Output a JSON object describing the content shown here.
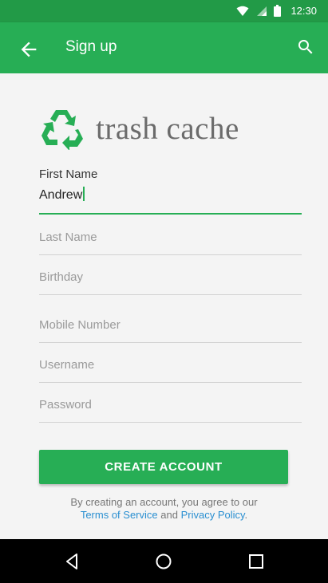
{
  "status_bar": {
    "time": "12:30",
    "icons": [
      "wifi-icon",
      "signal-icon",
      "battery-icon"
    ]
  },
  "app_bar": {
    "title": "Sign up",
    "back_icon": "arrow-back-icon",
    "search_icon": "search-icon"
  },
  "logo": {
    "icon": "recycle-icon",
    "text": "trash cache"
  },
  "form": {
    "first_name": {
      "label": "First Name",
      "value": "Andrew"
    },
    "last_name": {
      "placeholder": "Last Name"
    },
    "birthday": {
      "placeholder": "Birthday"
    },
    "mobile": {
      "placeholder": "Mobile Number"
    },
    "username": {
      "placeholder": "Username"
    },
    "password": {
      "placeholder": "Password"
    }
  },
  "create_button": {
    "label": "CREATE ACCOUNT"
  },
  "terms": {
    "line1": "By creating an account, you agree to our",
    "tos": "Terms of Service",
    "and": "and",
    "privacy": "Privacy Policy",
    "period": "."
  },
  "colors": {
    "primary": "#27ae55",
    "primary_dark": "#229a47",
    "link": "#2a8fd1"
  },
  "nav_bar": {
    "icons": [
      "back-triangle-icon",
      "home-circle-icon",
      "recents-square-icon"
    ]
  }
}
